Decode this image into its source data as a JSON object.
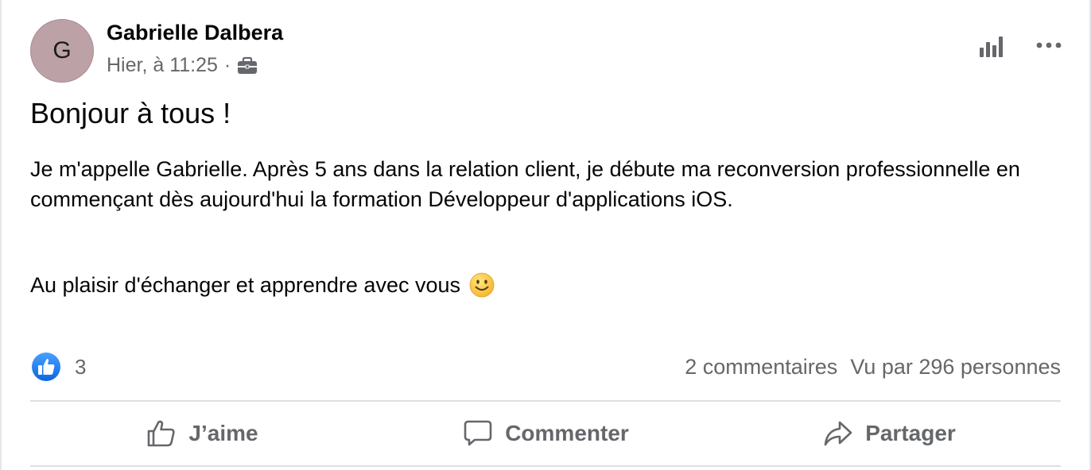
{
  "post": {
    "author": {
      "name": "Gabrielle Dalbera",
      "initial": "G",
      "avatar_color": "#bca1a6"
    },
    "timestamp": "Hier, à 11:25",
    "separator": "·",
    "audience_icon": "briefcase-icon",
    "title": "Bonjour à tous !",
    "body": [
      "Je m'appelle Gabrielle. Après 5 ans dans la relation client, je débute ma reconversion professionnelle en commençant dès aujourd'hui la formation Développeur d'applications iOS."
    ],
    "closing": "Au plaisir d'échanger et apprendre avec vous",
    "closing_emoji": "smile-icon"
  },
  "header_actions": {
    "stats_icon": "stats-icon",
    "more_icon": "more-icon"
  },
  "reactions": {
    "like_count": "3",
    "comments": "2 commentaires",
    "views": "Vu par 296 personnes",
    "accent_color": "#1877f2"
  },
  "actions": {
    "like_label": "J’aime",
    "comment_label": "Commenter",
    "share_label": "Partager"
  },
  "colors": {
    "text_primary": "#050505",
    "text_secondary": "#65676b",
    "divider": "#dddfe2"
  }
}
